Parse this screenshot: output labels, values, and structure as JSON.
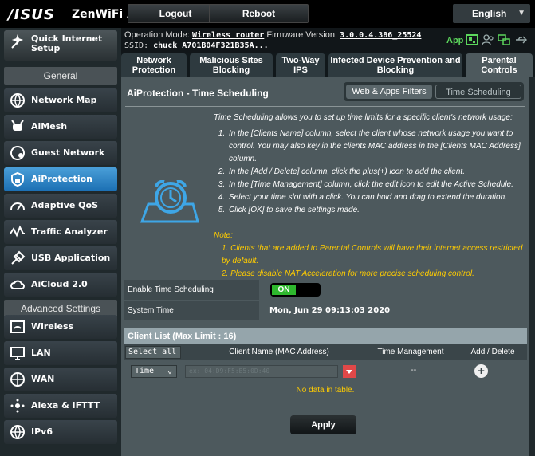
{
  "header": {
    "brand": "/ISUS",
    "model": "ZenWiFi AX",
    "logout": "Logout",
    "reboot": "Reboot",
    "language": "English"
  },
  "info": {
    "op_mode_label": "Operation Mode:",
    "op_mode": "Wireless router",
    "fw_label": "Firmware Version:",
    "fw": "3.0.0.4.386_25524",
    "ssid_label": "SSID:",
    "ssid1": "chuck",
    "ssid2": "A701B04F321B35A...",
    "app": "App"
  },
  "sidebar": {
    "quick_setup": "Quick Internet Setup",
    "general": "General",
    "items": [
      {
        "label": "Network Map",
        "icon": "network-map-icon"
      },
      {
        "label": "AiMesh",
        "icon": "aimesh-icon"
      },
      {
        "label": "Guest Network",
        "icon": "guest-network-icon"
      },
      {
        "label": "AiProtection",
        "icon": "aiprotection-icon"
      },
      {
        "label": "Adaptive QoS",
        "icon": "qos-icon"
      },
      {
        "label": "Traffic Analyzer",
        "icon": "traffic-icon"
      },
      {
        "label": "USB Application",
        "icon": "usb-icon"
      },
      {
        "label": "AiCloud 2.0",
        "icon": "cloud-icon"
      }
    ],
    "advanced": "Advanced Settings",
    "adv_items": [
      {
        "label": "Wireless",
        "icon": "wireless-icon"
      },
      {
        "label": "LAN",
        "icon": "lan-icon"
      },
      {
        "label": "WAN",
        "icon": "wan-icon"
      },
      {
        "label": "Alexa & IFTTT",
        "icon": "alexa-icon"
      },
      {
        "label": "IPv6",
        "icon": "ipv6-icon"
      }
    ]
  },
  "tabs": [
    {
      "label": "Network Protection"
    },
    {
      "label": "Malicious Sites Blocking"
    },
    {
      "label": "Two-Way IPS"
    },
    {
      "label": "Infected Device Prevention and Blocking"
    },
    {
      "label": "Parental Controls"
    }
  ],
  "panel": {
    "title": "AiProtection - Time Scheduling",
    "seg_web": "Web & Apps Filters",
    "seg_time": "Time Scheduling",
    "intro": "Time Scheduling allows you to set up time limits for a specific client's network usage:",
    "steps": [
      "In the [Clients Name] column, select the client whose network usage you want to control. You may also key in the clients MAC address in the [Clients MAC Address] column.",
      "In the [Add / Delete] column, click the plus(+) icon to add the client.",
      "In the [Time Management] column, click the edit icon to edit the Active Schedule.",
      "Select your time slot with a click. You can hold and drag to extend the duration.",
      "Click [OK] to save the settings made."
    ],
    "note_head": "Note:",
    "note1": "1. Clients that are added to Parental Controls will have their internet access restricted by default.",
    "note2_pre": "2. Please disable ",
    "note2_link": "NAT Acceleration",
    "note2_post": " for more precise scheduling control.",
    "enable_label": "Enable Time Scheduling",
    "enable_value": "ON",
    "systime_label": "System Time",
    "systime_value": "Mon, Jun 29 09:13:03 2020"
  },
  "client_list": {
    "title": "Client List (Max Limit : 16)",
    "select_all": "Select all",
    "col_name": "Client Name (MAC Address)",
    "col_time": "Time Management",
    "col_add": "Add / Delete",
    "row_select": "Time",
    "mac_placeholder": "ex: 04:D9:F5:B5:0D:40",
    "dash": "--",
    "add": "+",
    "empty": "No data in table.",
    "apply": "Apply"
  },
  "colors": {
    "panel": "#4d595d",
    "active_menu": "#1b6fb3",
    "toggle_on": "#2eb82e",
    "note": "#ffcc00"
  }
}
